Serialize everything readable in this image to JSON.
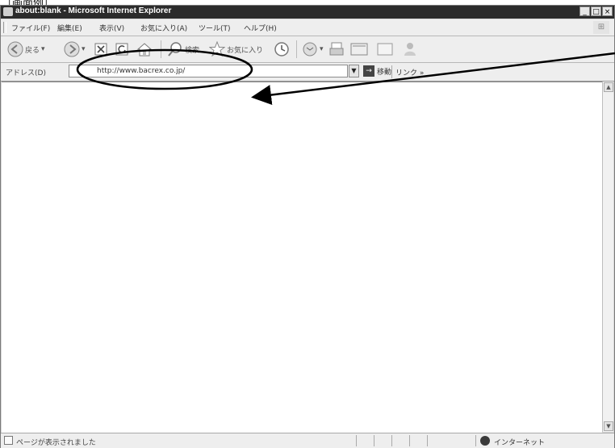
{
  "caption": "［画面例］",
  "window": {
    "title": "about:blank - Microsoft Internet Explorer",
    "minimize": "_",
    "maximize": "□",
    "close": "×"
  },
  "menu": {
    "items": [
      "ファイル(F)",
      "編集(E)",
      "表示(V)",
      "お気に入り(A)",
      "ツール(T)",
      "ヘルプ(H)"
    ]
  },
  "toolbar": {
    "back_label": "戻る",
    "search_label": "検索",
    "favorites_label": "お気に入り"
  },
  "address": {
    "label": "アドレス(D)",
    "url": "http://www.bacrex.co.jp/",
    "go_label": "移動",
    "links_label": "リンク »"
  },
  "status": {
    "text": "ページが表示されました",
    "zone": "インターネット"
  }
}
